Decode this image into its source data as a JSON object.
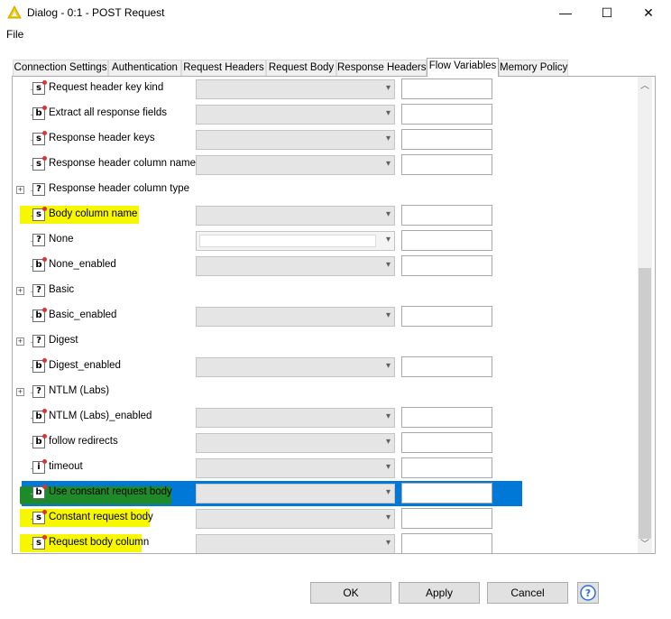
{
  "window": {
    "title": "Dialog - 0:1 - POST Request",
    "controls": {
      "minimize": "—",
      "maximize": "☐",
      "close": "✕"
    }
  },
  "menu": {
    "file": "File"
  },
  "tabs": [
    {
      "label": "Connection Settings",
      "active": false
    },
    {
      "label": "Authentication",
      "active": false
    },
    {
      "label": "Request Headers",
      "active": false
    },
    {
      "label": "Request Body",
      "active": false
    },
    {
      "label": "Response Headers",
      "active": false
    },
    {
      "label": "Flow Variables",
      "active": true
    },
    {
      "label": "Memory Policy",
      "active": false
    }
  ],
  "rows": [
    {
      "label": "Request header key kind",
      "icon": "s",
      "has_controls": true
    },
    {
      "label": "Extract all response fields",
      "icon": "b",
      "has_controls": true
    },
    {
      "label": "Response header keys",
      "icon": "s",
      "has_controls": true
    },
    {
      "label": "Response header column name",
      "icon": "s",
      "has_controls": true
    },
    {
      "label": "Response header column type",
      "icon": "?",
      "has_controls": false,
      "expander": true
    },
    {
      "label": "Body column name",
      "icon": "s",
      "has_controls": true,
      "highlight": true
    },
    {
      "label": "None",
      "icon": "?",
      "has_controls": true
    },
    {
      "label": "None_enabled",
      "icon": "b",
      "has_controls": true
    },
    {
      "label": "Basic",
      "icon": "?",
      "has_controls": false,
      "expander": true
    },
    {
      "label": "Basic_enabled",
      "icon": "b",
      "has_controls": true
    },
    {
      "label": "Digest",
      "icon": "?",
      "has_controls": false,
      "expander": true
    },
    {
      "label": "Digest_enabled",
      "icon": "b",
      "has_controls": true
    },
    {
      "label": "NTLM (Labs)",
      "icon": "?",
      "has_controls": false,
      "expander": true
    },
    {
      "label": "NTLM (Labs)_enabled",
      "icon": "b",
      "has_controls": true
    },
    {
      "label": "follow redirects",
      "icon": "b",
      "has_controls": true
    },
    {
      "label": "timeout",
      "icon": "i",
      "has_controls": true
    },
    {
      "label": "Use constant request body",
      "icon": "b",
      "has_controls": true,
      "selected": true
    },
    {
      "label": "Constant request body",
      "icon": "s",
      "has_controls": true,
      "highlight": true
    },
    {
      "label": "Request body column",
      "icon": "s",
      "has_controls": true,
      "highlight": true
    }
  ],
  "buttons": {
    "ok": "OK",
    "apply": "Apply",
    "cancel": "Cancel",
    "help": "?"
  },
  "colors": {
    "highlight": "#f7f700",
    "selection": "#0078d7",
    "green_mark": "#1f8a2a"
  }
}
